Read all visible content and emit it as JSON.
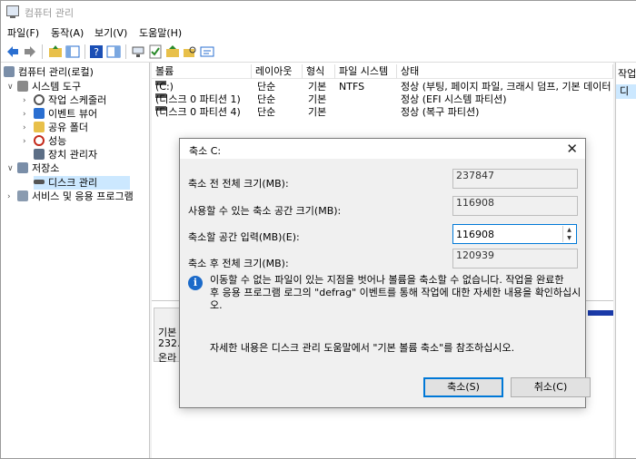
{
  "window": {
    "title": "컴퓨터 관리"
  },
  "menu": [
    "파일(F)",
    "동작(A)",
    "보기(V)",
    "도움말(H)"
  ],
  "tree": {
    "root": "컴퓨터 관리(로컬)",
    "system_tools": "시스템 도구",
    "task_scheduler": "작업 스케줄러",
    "event_viewer": "이벤트 뷰어",
    "shared_folders": "공유 폴더",
    "performance": "성능",
    "device_manager": "장치 관리자",
    "storage": "저장소",
    "disk_management": "디스크 관리",
    "services": "서비스 및 응용 프로그램"
  },
  "columns": [
    "볼륨",
    "레이아웃",
    "형식",
    "파일 시스템",
    "상태"
  ],
  "volumes": [
    {
      "name": "(C:)",
      "layout": "단순",
      "type": "기본",
      "fs": "NTFS",
      "status": "정상 (부팅, 페이지 파일, 크래시 덤프, 기본 데이터"
    },
    {
      "name": "(디스크 0 파티션 1)",
      "layout": "단순",
      "type": "기본",
      "fs": "",
      "status": "정상 (EFI 시스템 파티션)"
    },
    {
      "name": "(디스크 0 파티션 4)",
      "layout": "단순",
      "type": "기본",
      "fs": "",
      "status": "정상 (복구 파티션)"
    }
  ],
  "disk_panel": {
    "line1": "기본",
    "line2": "232.",
    "line3": "온라"
  },
  "action_pane": {
    "header": "작업",
    "item": "디스"
  },
  "dialog": {
    "title": "축소 C:",
    "total_before_label": "축소 전 전체 크기(MB):",
    "total_before_value": "237847",
    "available_label": "사용할 수 있는 축소 공간 크기(MB):",
    "available_value": "116908",
    "enter_label": "축소할 공간 입력(MB)(E):",
    "enter_value": "116908",
    "total_after_label": "축소 후 전체 크기(MB):",
    "total_after_value": "120939",
    "info_lines": [
      "이동할 수 없는 파일이 있는 지점을 벗어나 볼륨을 축소할 수 없습니다. 작업을 완료한",
      "후 응용 프로그램 로그의 \"defrag\" 이벤트를 통해 작업에 대한 자세한 내용을 확인하십시",
      "오."
    ],
    "help": "자세한 내용은 디스크 관리 도움말에서 \"기본 볼륨 축소\"를 참조하십시오.",
    "shrink_button": "축소(S)",
    "cancel_button": "취소(C)"
  },
  "colors": {
    "accent": "#0078d7",
    "selection": "#cce8ff",
    "info": "#1b6ac9"
  }
}
